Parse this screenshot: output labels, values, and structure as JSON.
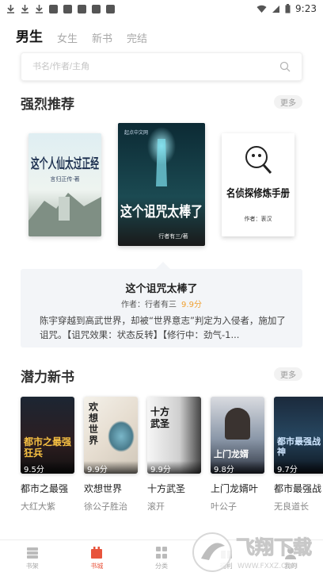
{
  "status_bar": {
    "time": "9:23",
    "icons": [
      "download-icon",
      "download-icon",
      "download-icon",
      "app-icon",
      "app-icon",
      "app-icon",
      "app-icon",
      "app-icon"
    ]
  },
  "gender_tabs": [
    {
      "label": "男生",
      "active": true
    },
    {
      "label": "女生",
      "active": false
    },
    {
      "label": "新书",
      "active": false
    },
    {
      "label": "完结",
      "active": false
    }
  ],
  "search": {
    "placeholder": "书名/作者/主角"
  },
  "recommend": {
    "title": "强烈推荐",
    "more_label": "更多",
    "books": [
      {
        "cover_title": "这个人仙太过正经",
        "cover_sub": "言归正传·著"
      },
      {
        "cover_title": "这个诅咒太棒了",
        "cover_sub": "行者有三/著",
        "publisher": "起点中文网"
      },
      {
        "cover_title": "名侦探修炼手册",
        "cover_sub": "作者：衷汉"
      }
    ],
    "selected": {
      "title": "这个诅咒太棒了",
      "author_label": "作者：行者有三",
      "score": "9.9分",
      "description": "陈宇穿越到高武世界，却被“世界意志”判定为入侵者，施加了诅咒。【诅咒效果：状态反转】【修行中：劲气-1..."
    }
  },
  "new_books": {
    "title": "潜力新书",
    "more_label": "更多",
    "items": [
      {
        "title": "都市之最强",
        "author": "大红大紫",
        "score": "9.5分",
        "cover_text": "都市之最强狂兵"
      },
      {
        "title": "欢想世界",
        "author": "徐公子胜治",
        "score": "9.9分",
        "cover_text": "欢想世界"
      },
      {
        "title": "十方武圣",
        "author": "滚开",
        "score": "9.9分",
        "cover_text": "十方武圣"
      },
      {
        "title": "上门龙婿叶",
        "author": "叶公子",
        "score": "9.8分",
        "cover_text": "上门龙婿"
      },
      {
        "title": "都市最强战",
        "author": "无良道长",
        "score": "9.7分",
        "cover_text": "都市最强战神"
      }
    ]
  },
  "bottom_nav": [
    {
      "label": "书架",
      "icon": "bookshelf-icon",
      "active": false
    },
    {
      "label": "书城",
      "icon": "bookstore-icon",
      "active": true
    },
    {
      "label": "分类",
      "icon": "category-icon",
      "active": false
    },
    {
      "label": "福利",
      "icon": "gift-icon",
      "active": false
    },
    {
      "label": "我的",
      "icon": "user-icon",
      "active": false
    }
  ],
  "watermark": {
    "text": "飞翔下载",
    "url_text": "WWW.FXXZ.COM"
  },
  "colors": {
    "accent": "#e8543c",
    "score": "#f0a030",
    "card_bg": "#f3f5f8"
  }
}
